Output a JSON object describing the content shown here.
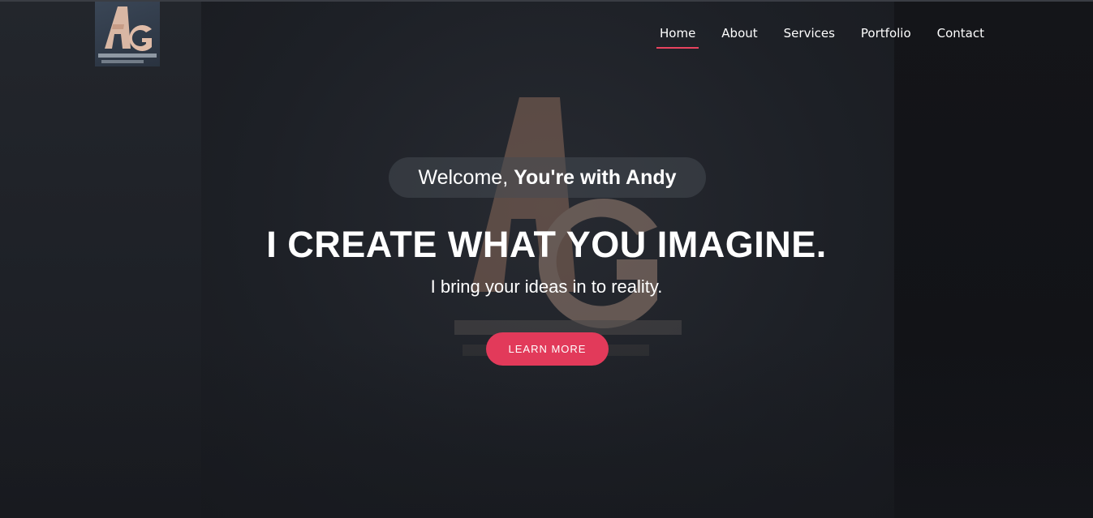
{
  "nav": {
    "items": [
      {
        "label": "Home",
        "active": true
      },
      {
        "label": "About",
        "active": false
      },
      {
        "label": "Services",
        "active": false
      },
      {
        "label": "Portfolio",
        "active": false
      },
      {
        "label": "Contact",
        "active": false
      }
    ]
  },
  "hero": {
    "welcome_prefix": "Welcome,",
    "welcome_bold": "You're with Andy",
    "headline": "I CREATE WHAT YOU IMAGINE.",
    "subline": "I bring your ideas in to reality.",
    "cta_label": "LEARN MORE"
  },
  "logo": {
    "mark": "AG",
    "tagline": "ANDY'S GRAPHICS DESIGN"
  },
  "colors": {
    "accent": "#e23a5a",
    "nav_underline": "#e8435f",
    "text": "#ffffff"
  }
}
